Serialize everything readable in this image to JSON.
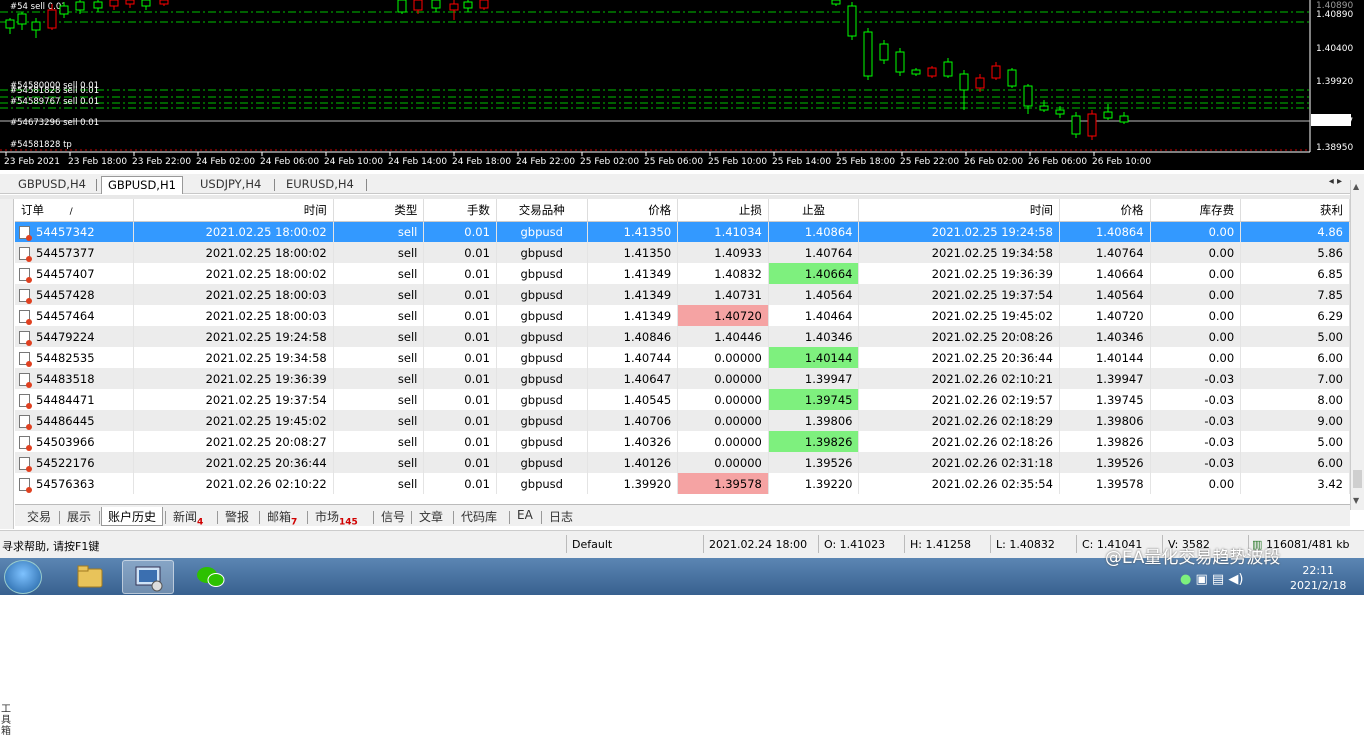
{
  "chart": {
    "price_axis": [
      "1.40890",
      "1.40400",
      "1.39920",
      "1.39357",
      "1.38950"
    ],
    "current_price": "1.39357",
    "top_price": "1.40890",
    "time_axis": [
      "23 Feb 2021",
      "23 Feb 18:00",
      "23 Feb 22:00",
      "24 Feb 02:00",
      "24 Feb 06:00",
      "24 Feb 10:00",
      "24 Feb 14:00",
      "24 Feb 18:00",
      "24 Feb 22:00",
      "25 Feb 02:00",
      "25 Feb 06:00",
      "25 Feb 10:00",
      "25 Feb 14:00",
      "25 Feb 18:00",
      "25 Feb 22:00",
      "26 Feb 02:00",
      "26 Feb 06:00",
      "26 Feb 10:00"
    ],
    "order_labels": [
      "#54580000 sell 0.01",
      "#54581828 sell 0.01",
      "#54589767 sell 0.01",
      "#54673296 sell 0.01",
      "#54581828 tp"
    ],
    "top_order_label": "#54 sell 0.01",
    "colors": {
      "bull": "#00ff00",
      "bear": "#ff0000",
      "grid": "#00c000"
    }
  },
  "chart_tabs": [
    "GBPUSD,H4",
    "GBPUSD,H1",
    "USDJPY,H4",
    "EURUSD,H4"
  ],
  "table": {
    "headers": [
      "订单",
      "/",
      "时间",
      "类型",
      "手数",
      "交易品种",
      "价格",
      "止损",
      "止盈",
      "时间",
      "价格",
      "库存费",
      "获利"
    ],
    "rows": [
      [
        "54457342",
        "2021.02.25 18:00:02",
        "sell",
        "0.01",
        "gbpusd",
        "1.41350",
        "1.41034",
        "1.40864",
        "2021.02.25 19:24:58",
        "1.40864",
        "0.00",
        "4.86"
      ],
      [
        "54457377",
        "2021.02.25 18:00:02",
        "sell",
        "0.01",
        "gbpusd",
        "1.41350",
        "1.40933",
        "1.40764",
        "2021.02.25 19:34:58",
        "1.40764",
        "0.00",
        "5.86"
      ],
      [
        "54457407",
        "2021.02.25 18:00:02",
        "sell",
        "0.01",
        "gbpusd",
        "1.41349",
        "1.40832",
        "1.40664",
        "2021.02.25 19:36:39",
        "1.40664",
        "0.00",
        "6.85"
      ],
      [
        "54457428",
        "2021.02.25 18:00:03",
        "sell",
        "0.01",
        "gbpusd",
        "1.41349",
        "1.40731",
        "1.40564",
        "2021.02.25 19:37:54",
        "1.40564",
        "0.00",
        "7.85"
      ],
      [
        "54457464",
        "2021.02.25 18:00:03",
        "sell",
        "0.01",
        "gbpusd",
        "1.41349",
        "1.40720",
        "1.40464",
        "2021.02.25 19:45:02",
        "1.40720",
        "0.00",
        "6.29"
      ],
      [
        "54479224",
        "2021.02.25 19:24:58",
        "sell",
        "0.01",
        "gbpusd",
        "1.40846",
        "1.40446",
        "1.40346",
        "2021.02.25 20:08:26",
        "1.40346",
        "0.00",
        "5.00"
      ],
      [
        "54482535",
        "2021.02.25 19:34:58",
        "sell",
        "0.01",
        "gbpusd",
        "1.40744",
        "0.00000",
        "1.40144",
        "2021.02.25 20:36:44",
        "1.40144",
        "0.00",
        "6.00"
      ],
      [
        "54483518",
        "2021.02.25 19:36:39",
        "sell",
        "0.01",
        "gbpusd",
        "1.40647",
        "0.00000",
        "1.39947",
        "2021.02.26 02:10:21",
        "1.39947",
        "-0.03",
        "7.00"
      ],
      [
        "54484471",
        "2021.02.25 19:37:54",
        "sell",
        "0.01",
        "gbpusd",
        "1.40545",
        "0.00000",
        "1.39745",
        "2021.02.26 02:19:57",
        "1.39745",
        "-0.03",
        "8.00"
      ],
      [
        "54486445",
        "2021.02.25 19:45:02",
        "sell",
        "0.01",
        "gbpusd",
        "1.40706",
        "0.00000",
        "1.39806",
        "2021.02.26 02:18:29",
        "1.39806",
        "-0.03",
        "9.00"
      ],
      [
        "54503966",
        "2021.02.25 20:08:27",
        "sell",
        "0.01",
        "gbpusd",
        "1.40326",
        "0.00000",
        "1.39826",
        "2021.02.26 02:18:26",
        "1.39826",
        "-0.03",
        "5.00"
      ],
      [
        "54522176",
        "2021.02.25 20:36:44",
        "sell",
        "0.01",
        "gbpusd",
        "1.40126",
        "0.00000",
        "1.39526",
        "2021.02.26 02:31:18",
        "1.39526",
        "-0.03",
        "6.00"
      ],
      [
        "54576363",
        "2021.02.26 02:10:22",
        "sell",
        "0.01",
        "gbpusd",
        "1.39920",
        "1.39578",
        "1.39220",
        "2021.02.26 02:35:54",
        "1.39578",
        "0.00",
        "3.42"
      ]
    ],
    "row_highlights": [
      {
        "tp": true,
        "sl": false
      },
      {
        "tp": true,
        "sl": false
      },
      {
        "tp": true,
        "sl": false
      },
      {
        "tp": true,
        "sl": false
      },
      {
        "tp": false,
        "sl": true
      },
      {
        "tp": true,
        "sl": false
      },
      {
        "tp": true,
        "sl": false
      },
      {
        "tp": true,
        "sl": false
      },
      {
        "tp": true,
        "sl": false
      },
      {
        "tp": true,
        "sl": false
      },
      {
        "tp": true,
        "sl": false
      },
      {
        "tp": true,
        "sl": false
      },
      {
        "tp": false,
        "sl": true
      }
    ],
    "selected_row": 0
  },
  "bottom_tabs": [
    {
      "label": "交易",
      "badge": ""
    },
    {
      "label": "展示",
      "badge": ""
    },
    {
      "label": "账户历史",
      "badge": ""
    },
    {
      "label": "新闻",
      "badge": "4"
    },
    {
      "label": "警报",
      "badge": ""
    },
    {
      "label": "邮箱",
      "badge": "7"
    },
    {
      "label": "市场",
      "badge": "145"
    },
    {
      "label": "信号",
      "badge": ""
    },
    {
      "label": "文章",
      "badge": ""
    },
    {
      "label": "代码库",
      "badge": ""
    },
    {
      "label": "EA",
      "badge": ""
    },
    {
      "label": "日志",
      "badge": ""
    }
  ],
  "active_bottom_tab": 2,
  "side_label": "工具箱",
  "status": {
    "help_text": "寻求帮助, 请按F1键",
    "profile": "Default",
    "datetime": "2021.02.24 18:00",
    "open": "O: 1.41023",
    "high": "H: 1.41258",
    "low": "L: 1.40832",
    "close": "C: 1.41041",
    "volume": "V: 3582",
    "traffic": "116081/481 kb"
  },
  "taskbar": {
    "watermark": "@EA量化交易趋势波段",
    "time": "22:11",
    "date": "2021/2/18"
  }
}
